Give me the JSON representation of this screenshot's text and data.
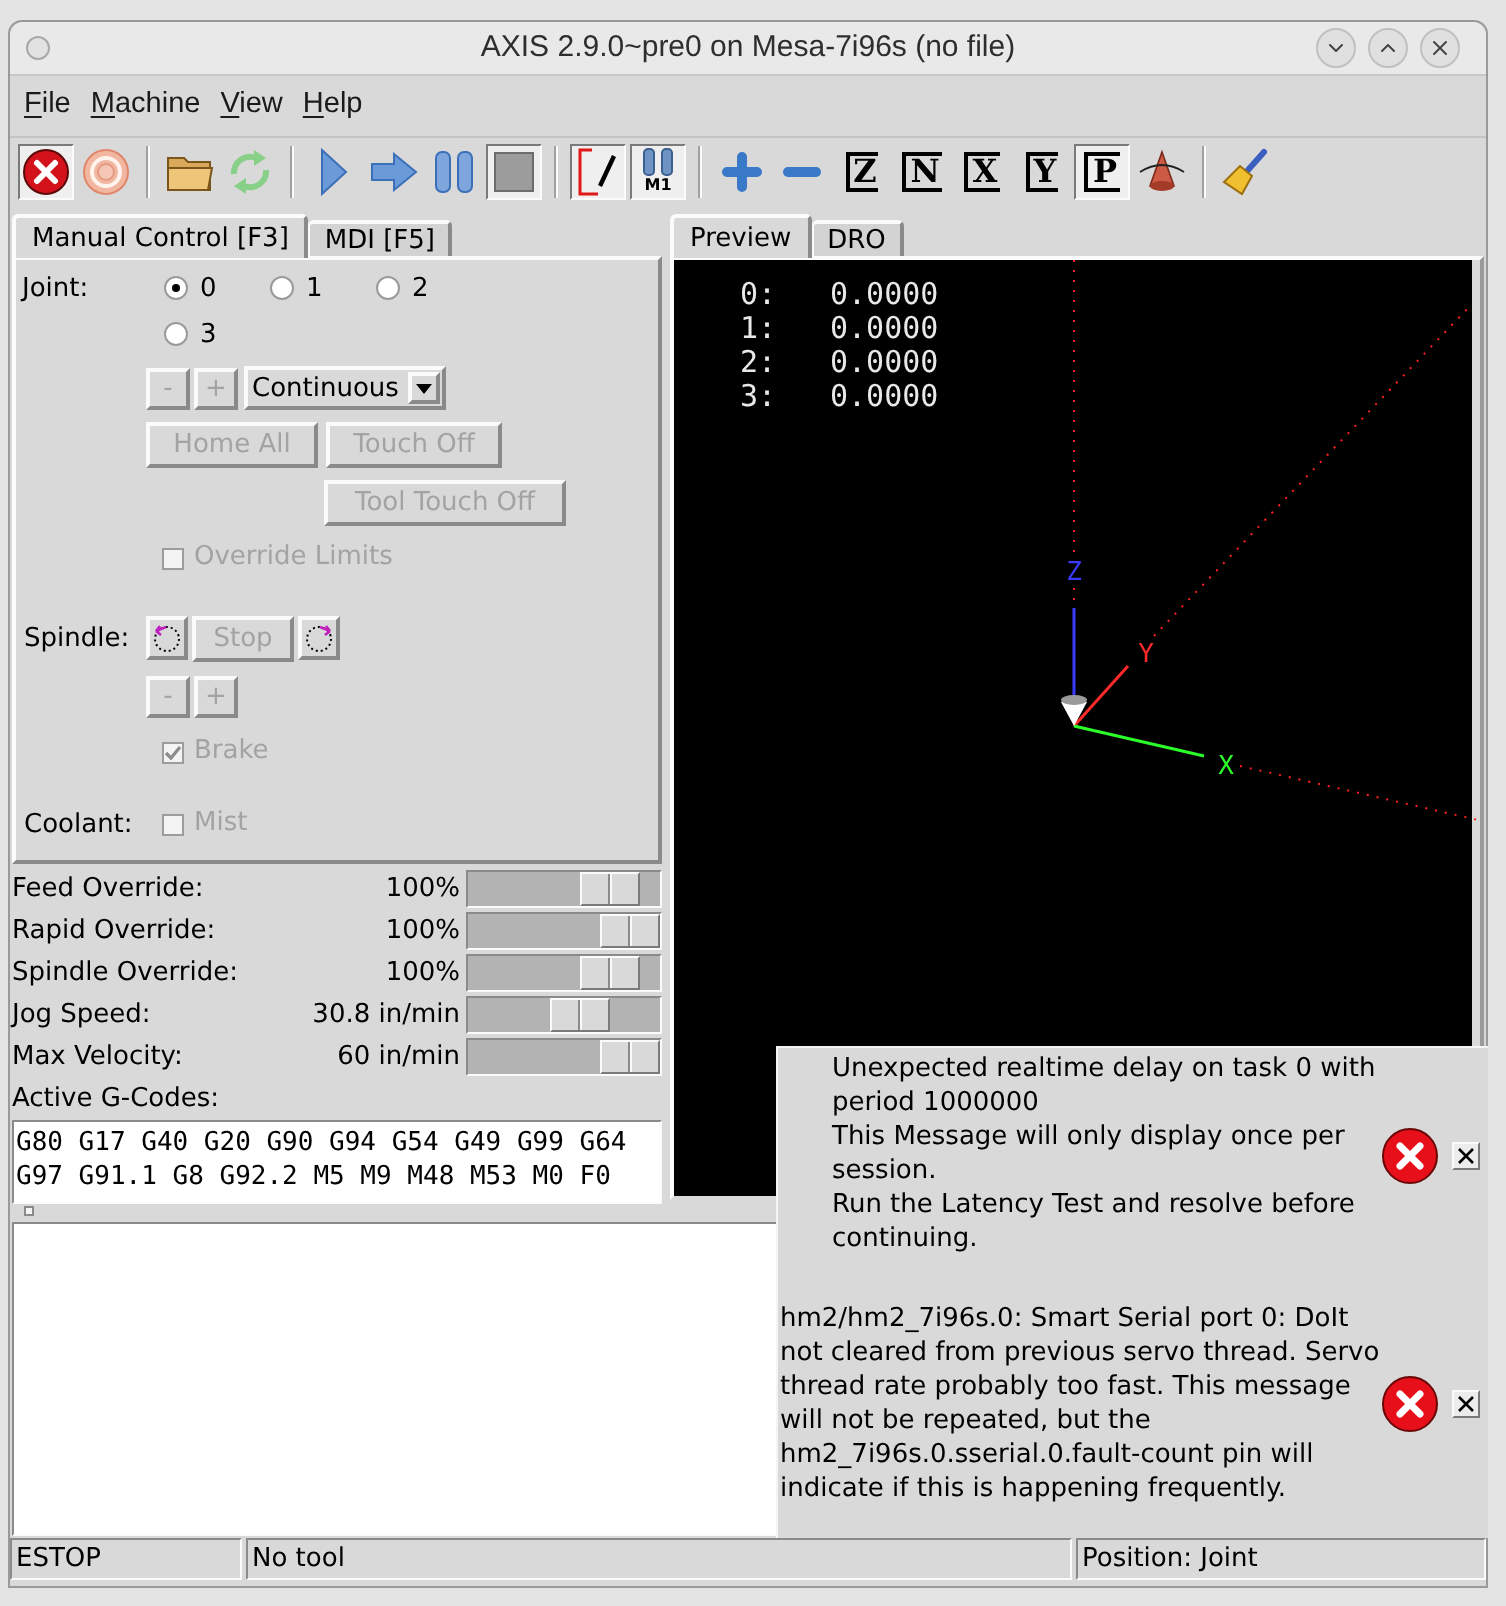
{
  "window": {
    "title": "AXIS 2.9.0~pre0 on Mesa-7i96s (no file)"
  },
  "menu": [
    "File",
    "Machine",
    "View",
    "Help"
  ],
  "toolbar": [
    {
      "kind": "estop",
      "pressed": true
    },
    {
      "kind": "power",
      "pressed": false
    },
    {
      "kind": "separator"
    },
    {
      "kind": "open",
      "pressed": false
    },
    {
      "kind": "reload",
      "pressed": false
    },
    {
      "kind": "separator"
    },
    {
      "kind": "run",
      "pressed": false
    },
    {
      "kind": "step",
      "pressed": false
    },
    {
      "kind": "pause",
      "pressed": false
    },
    {
      "kind": "stop",
      "pressed": true
    },
    {
      "kind": "separator"
    },
    {
      "kind": "block_delete",
      "pressed": true
    },
    {
      "kind": "optional_stop",
      "label": "M1",
      "pressed": true
    },
    {
      "kind": "separator"
    },
    {
      "kind": "zoom_in",
      "pressed": false
    },
    {
      "kind": "zoom_out",
      "pressed": false
    },
    {
      "kind": "view",
      "label": "Z",
      "pressed": false
    },
    {
      "kind": "view",
      "label": "N",
      "pressed": false
    },
    {
      "kind": "view",
      "label": "X",
      "pressed": false
    },
    {
      "kind": "view",
      "label": "Y",
      "pressed": false
    },
    {
      "kind": "view",
      "label": "P",
      "pressed": true
    },
    {
      "kind": "rotate",
      "pressed": false
    },
    {
      "kind": "separator"
    },
    {
      "kind": "clear",
      "pressed": false
    }
  ],
  "left_tabs": [
    {
      "label": "Manual Control [F3]",
      "selected": true
    },
    {
      "label": "MDI [F5]",
      "selected": false
    }
  ],
  "manual_control": {
    "joint_label": "Joint:",
    "joints": [
      {
        "label": "0",
        "selected": true
      },
      {
        "label": "1",
        "selected": false
      },
      {
        "label": "2",
        "selected": false
      },
      {
        "label": "3",
        "selected": false
      }
    ],
    "jog_buttons": [
      {
        "label": "-",
        "disabled": true
      },
      {
        "label": "+",
        "disabled": true
      }
    ],
    "jog_increment": {
      "value": "Continuous"
    },
    "home_all": {
      "label": "Home All",
      "disabled": true
    },
    "touch_off": {
      "label": "Touch Off",
      "disabled": true
    },
    "tool_touch_off": {
      "label": "Tool Touch Off",
      "disabled": true
    },
    "override_limits": {
      "label": "Override Limits",
      "checked": false,
      "disabled": true
    },
    "spindle_label": "Spindle:",
    "spindle_stop": {
      "label": "Stop",
      "disabled": true
    },
    "spindle_buttons": [
      {
        "label": "-",
        "disabled": true
      },
      {
        "label": "+",
        "disabled": true
      }
    ],
    "brake": {
      "label": "Brake",
      "checked": true,
      "disabled": true
    },
    "coolant_label": "Coolant:",
    "mist": {
      "label": "Mist",
      "checked": false,
      "disabled": true
    }
  },
  "sliders": [
    {
      "label": "Feed Override:",
      "reading": "100%",
      "level": 0.85
    },
    {
      "label": "Rapid Override:",
      "reading": "100%",
      "level": 1
    },
    {
      "label": "Spindle Override:",
      "reading": "100%",
      "level": 0.85
    },
    {
      "label": "Jog Speed:",
      "reading": "30.8 in/min",
      "level": 0.62
    },
    {
      "label": "Max Velocity:",
      "reading": "60 in/min",
      "level": 1
    }
  ],
  "active_gcodes": {
    "label": "Active G-Codes:",
    "lines": [
      "G80 G17 G40 G20 G90 G94 G54 G49 G99 G64",
      "G97 G91.1 G8 G92.2 M5 M9 M48 M53 M0 F0"
    ]
  },
  "right_tabs": [
    {
      "label": "Preview",
      "selected": true
    },
    {
      "label": "DRO",
      "selected": false
    }
  ],
  "preview": {
    "dro": [
      {
        "axis": "0:",
        "value": "0.0000"
      },
      {
        "axis": "1:",
        "value": "0.0000"
      },
      {
        "axis": "2:",
        "value": "0.0000"
      },
      {
        "axis": "3:",
        "value": "0.0000"
      }
    ],
    "axes": [
      {
        "label": "Z",
        "color": "#3a3aff"
      },
      {
        "label": "Y",
        "color": "#ff2a2a"
      },
      {
        "label": "X",
        "color": "#2aff2a"
      }
    ]
  },
  "messages": [
    {
      "kind": "error",
      "lines": [
        "Unexpected realtime delay on task 0 with",
        "period 1000000",
        "This Message will only display once per",
        "session.",
        "Run the Latency Test and resolve before",
        "continuing."
      ]
    },
    {
      "kind": "error",
      "lines": [
        "hm2/hm2_7i96s.0: Smart Serial port 0: DoIt",
        "not cleared from previous servo thread. Servo",
        "thread rate probably too fast. This message",
        "will not be repeated, but the",
        "hm2_7i96s.0.sserial.0.fault-count pin will",
        "indicate if this is happening frequently."
      ]
    }
  ],
  "status_bar": [
    "ESTOP",
    "No tool",
    "Position: Joint"
  ]
}
